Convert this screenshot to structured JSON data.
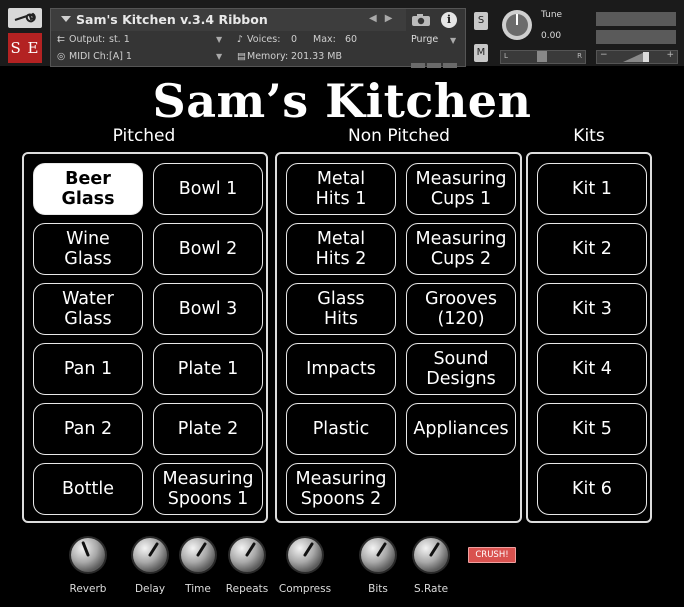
{
  "header": {
    "instrument_name": "Sam's Kitchen v.3.4 Ribbon",
    "output_label": "Output:",
    "output_value": "st. 1",
    "voices_label": "Voices:",
    "voices_value": "0",
    "max_label": "Max:",
    "max_value": "60",
    "midi_label": "MIDI Ch:",
    "midi_value": "[A]  1",
    "memory_label": "Memory:",
    "memory_value": "201.33 MB",
    "purge_label": "Purge",
    "solo_label": "S",
    "mute_label": "M",
    "tune_label": "Tune",
    "tune_value": "0.00",
    "pan_left": "L",
    "pan_right": "R",
    "logo_text": "S E"
  },
  "brand_title": "Sam’s Kitchen",
  "sections": {
    "pitched": {
      "title": "Pitched",
      "pads": [
        "Beer\nGlass",
        "Bowl 1",
        "Wine\nGlass",
        "Bowl 2",
        "Water\nGlass",
        "Bowl 3",
        "Pan 1",
        "Plate 1",
        "Pan 2",
        "Plate 2",
        "Bottle",
        "Measuring\nSpoons 1"
      ],
      "active_index": 0
    },
    "non_pitched": {
      "title": "Non Pitched",
      "pads": [
        "Metal\nHits 1",
        "Measuring\nCups 1",
        "Metal\nHits 2",
        "Measuring\nCups 2",
        "Glass\nHits",
        "Grooves\n(120)",
        "Impacts",
        "Sound\nDesigns",
        "Plastic",
        "Appliances",
        "Measuring\nSpoons 2"
      ]
    },
    "kits": {
      "title": "Kits",
      "pads": [
        "Kit 1",
        "Kit 2",
        "Kit 3",
        "Kit 4",
        "Kit 5",
        "Kit 6"
      ]
    }
  },
  "knobs": [
    {
      "label": "Reverb",
      "value": 0.42
    },
    {
      "label": "Delay",
      "value": 0.62
    },
    {
      "label": "Time",
      "value": 0.62
    },
    {
      "label": "Repeats",
      "value": 0.62
    },
    {
      "label": "Compress",
      "value": 0.62
    },
    {
      "label": "Bits",
      "value": 0.62
    },
    {
      "label": "S.Rate",
      "value": 0.62
    }
  ],
  "crush_label": "CRUSH!",
  "colors": {
    "background": "#000000",
    "pad_border": "#e8e8e8",
    "active_pad": "#ffffff",
    "crush": "#d9524f",
    "logo": "#b32222"
  }
}
